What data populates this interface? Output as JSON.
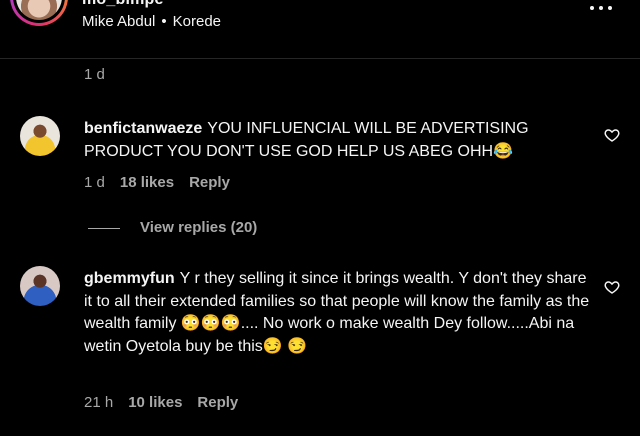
{
  "header": {
    "username": "mo_bimpe",
    "collaborators": [
      "Mike Abdul",
      "Korede"
    ],
    "separator": "•"
  },
  "post_time": "1 d",
  "comments": [
    {
      "username": "benfictanwaeze",
      "text": "YOU INFLUENCIAL WILL BE ADVERTISING PRODUCT YOU DON'T USE GOD HELP US ABEG OHH😂",
      "time": "1 d",
      "likes": "18 likes",
      "reply_label": "Reply",
      "view_replies": "View replies (20)",
      "avatar_icon": "profile-photo"
    },
    {
      "username": "gbemmyfun",
      "text": "Y r they selling it since it brings wealth. Y don't they share it to all their extended families so that people will know the family as the wealth family 😳😳😳.... No work o make wealth Dey follow.....Abi na wetin Oyetola buy be this😏 😏",
      "time": "21 h",
      "likes": "10 likes",
      "reply_label": "Reply",
      "avatar_icon": "profile-photo"
    }
  ],
  "icons": {
    "like": "heart-outline-icon",
    "more": "more-horizontal-icon"
  },
  "colors": {
    "background": "#000000",
    "text": "#f5f5f5",
    "secondary": "#a8a8a8"
  }
}
